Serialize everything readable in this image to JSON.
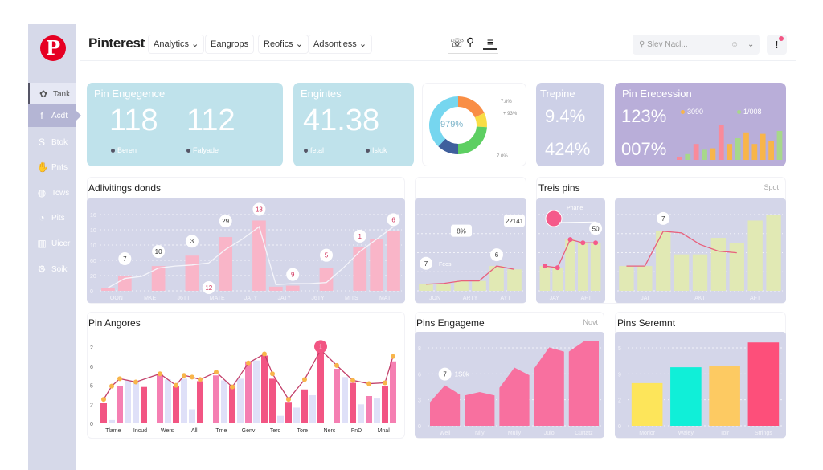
{
  "sidebar": {
    "logo": "P",
    "items": [
      {
        "label": "Tank",
        "icon": "paw-icon",
        "glyph": "✿"
      },
      {
        "label": "Acdt",
        "icon": "facebook-icon",
        "glyph": "f"
      },
      {
        "label": "Btok",
        "icon": "skype-icon",
        "glyph": "S"
      },
      {
        "label": "Pnts",
        "icon": "hand-icon",
        "glyph": "✋"
      },
      {
        "label": "Tcws",
        "icon": "globe-icon",
        "glyph": "◍"
      },
      {
        "label": "Pits",
        "icon": "gauge-icon",
        "glyph": "◔"
      },
      {
        "label": "Uicer",
        "icon": "factory-icon",
        "glyph": "▥"
      },
      {
        "label": "Soik",
        "icon": "gear-icon",
        "glyph": "⚙"
      }
    ]
  },
  "header": {
    "brand": "Pinterest",
    "menus": [
      {
        "label": "Analytics ⌄"
      },
      {
        "label": "Eangrops"
      },
      {
        "label": "Reofics ⌄"
      },
      {
        "label": "Adsontiess ⌄"
      }
    ],
    "icons": [
      "phone-icon",
      "search-icon",
      "list-icon"
    ],
    "search_placeholder": "Slev Nacl...",
    "user_icon": "user-icon",
    "bell": "!"
  },
  "kpis": {
    "engagement": {
      "title": "Pin Engegence",
      "v1": "118",
      "v2": "112",
      "l1": "Beren",
      "l2": "Falyade"
    },
    "engintes": {
      "title": "Engintes",
      "value": "41.38",
      "l1": "fetal",
      "l2": "Islok"
    },
    "donut": {
      "center": "979%",
      "labels": [
        "7.8%",
        "+ 93%",
        "7.0%"
      ],
      "segments": [
        {
          "value": 18,
          "color": "#f98e45"
        },
        {
          "value": 8,
          "color": "#f9dd45"
        },
        {
          "value": 24,
          "color": "#5dcf62"
        },
        {
          "value": 12,
          "color": "#3f5f9c"
        },
        {
          "value": 38,
          "color": "#76d6ef"
        }
      ]
    },
    "trepine": {
      "title": "Trepine",
      "v1": "9.4%",
      "v2": "424%"
    },
    "recession": {
      "title": "Pin Erecession",
      "v1": "123%",
      "v2": "007%",
      "leg1": "3090",
      "leg2": "1/008",
      "leg1_color": "#f8b54a",
      "leg2_color": "#a7d88a",
      "bars": [
        4,
        8,
        22,
        14,
        16,
        48,
        22,
        30,
        38,
        22,
        36,
        26,
        40
      ],
      "bar_colors": [
        "#f98a9a",
        "#a7d88a",
        "#f98a9a",
        "#a7d88a",
        "#f8b54a",
        "#f98a9a",
        "#f8b54a",
        "#a7d88a",
        "#f8b54a",
        "#f8b54a",
        "#f8b54a",
        "#f8b54a",
        "#a7d88a"
      ]
    }
  },
  "panels": {
    "activity_title": "Adlivitings donds",
    "trends_title": "Treis pins",
    "trends_action": "Spot",
    "angores_title": "Pin Angores",
    "engage_title": "Pins Engageme",
    "engage_action": "Novt",
    "segment_title": "Pins Seremnt"
  },
  "chart_data": [
    {
      "id": "activity",
      "type": "bar",
      "ymax": 80,
      "yticks": [
        "16",
        "10",
        "10",
        "60",
        "20",
        "0"
      ],
      "xlabels": [
        "OON",
        "MKE",
        "J6TT",
        "MATE",
        "JATY",
        "JATY",
        "J6TY",
        "MITS",
        "MAT"
      ],
      "values": [
        3,
        14,
        0,
        24,
        0,
        34,
        0,
        52,
        0,
        68,
        4,
        5,
        0,
        22,
        0,
        42,
        50,
        58
      ],
      "bar_color": "#f9b5c8",
      "line": [
        3,
        12,
        14,
        22,
        24,
        25,
        27,
        40,
        50,
        62,
        6,
        7,
        7,
        8,
        22,
        38,
        50,
        62
      ],
      "line_color": "#f4f4fa",
      "callouts": [
        {
          "i": 1,
          "label": "7",
          "dy": 22
        },
        {
          "i": 3,
          "label": "10",
          "dy": 18
        },
        {
          "i": 5,
          "label": "3",
          "dy": 18
        },
        {
          "i": 6,
          "label": "12",
          "dy": 4,
          "color": "#d0305a"
        },
        {
          "i": 7,
          "label": "29",
          "dy": 20
        },
        {
          "i": 9,
          "label": "13",
          "dy": 14,
          "color": "#d0305a"
        },
        {
          "i": 11,
          "label": "9",
          "dy": 14,
          "color": "#d0305a"
        },
        {
          "i": 13,
          "label": "5",
          "dy": 16,
          "color": "#d0305a"
        },
        {
          "i": 15,
          "label": "1",
          "dy": 14,
          "color": "#d0305a"
        },
        {
          "i": 17,
          "label": "6",
          "dy": 14,
          "color": "#d0305a"
        }
      ]
    },
    {
      "id": "pins-trend",
      "type": "bar",
      "ymax": 100,
      "yticks": [],
      "xlabels": [
        "JON",
        "ARTY",
        "AYT"
      ],
      "values": [
        8,
        8,
        12,
        12,
        30,
        26
      ],
      "bar_color": "#e1e9b4",
      "line": [
        8,
        9,
        12,
        12,
        30,
        26
      ],
      "line_color": "#e8607c",
      "callouts": [
        {
          "i": 0,
          "label": "7",
          "dy": 26
        },
        {
          "i": 2,
          "label": "8%",
          "dy": 62,
          "box": true
        },
        {
          "i": 4,
          "label": "6",
          "dy": 14
        },
        {
          "i": 5,
          "label": "22141",
          "dy": 60,
          "box": true
        }
      ],
      "note": "Feos"
    },
    {
      "id": "trends-small",
      "type": "bar",
      "ymax": 100,
      "yticks": [],
      "xlabels": [
        "JAY",
        "AFT"
      ],
      "values": [
        30,
        28,
        62,
        58,
        58
      ],
      "bar_color": "#e1e9b4",
      "line": [
        30,
        28,
        62,
        58,
        58
      ],
      "line_color": "#e8607c",
      "callouts": [
        {
          "i": 4,
          "label": "50",
          "dy": 18
        }
      ],
      "note": "Pnarle",
      "dot_color": "#f55a8a"
    },
    {
      "id": "trends-large",
      "type": "bar",
      "ymax": 100,
      "yticks": [],
      "xlabels": [
        "JAI",
        "AKT",
        "AFT"
      ],
      "values": [
        30,
        30,
        72,
        44,
        44,
        64,
        58,
        85,
        92
      ],
      "bar_color": "#e1e9b4",
      "line": [
        30,
        30,
        72,
        70,
        56,
        48,
        46
      ],
      "line_color": "#e8607c",
      "callouts": [
        {
          "i": 2,
          "label": "7",
          "dy": 16
        }
      ]
    },
    {
      "id": "angores",
      "type": "bar",
      "ymax": 10,
      "yticks": [
        "2",
        "6",
        "5",
        "2",
        "0"
      ],
      "xlabels": [
        "Tlame",
        "Incud",
        "Wers",
        "All",
        "Tme",
        "Genv",
        "Terd",
        "Tore",
        "Nerc",
        "FnD",
        "Mnal"
      ],
      "values": [
        2.5,
        0.4,
        4.5,
        5.2,
        5.2,
        4.4,
        0,
        5.9,
        5.3,
        4.5,
        5.4,
        1.7,
        5.1,
        0,
        5.8,
        5.2,
        4.6,
        5.4,
        7.5,
        7.6,
        8.2,
        5.4,
        0.9,
        2.6,
        1.9,
        4.1,
        3.4,
        8.9,
        0,
        6.6,
        5.6,
        4.9,
        2.3,
        3.3,
        3.0,
        4.5,
        7.5
      ],
      "bar_palette": [
        "#f25583",
        "#dfe0f8",
        "#f57fb2",
        "#dfe0f8",
        "#dfe0f8",
        "#f25583",
        "#fff",
        "#f57fb2",
        "#dfe0f8",
        "#f25583",
        "#dfe0f8",
        "#dfe0f8",
        "#f25583",
        "#fff",
        "#f57fb2",
        "#dfe0f8",
        "#f25583",
        "#dfe0f8",
        "#f57fb2",
        "#dfe0f8",
        "#f25583",
        "#f25583",
        "#dfe0f8",
        "#f25583",
        "#dfe0f8",
        "#f25583",
        "#dfe0f8",
        "#f25583",
        "#fff",
        "#f57fb2",
        "#dfe0f8",
        "#f25583",
        "#dfe0f8",
        "#f57fb2",
        "#dfe0f8",
        "#f25583",
        "#f57fb2"
      ],
      "line": [
        2.9,
        4.5,
        5.4,
        0,
        5.0,
        0,
        0,
        6.0,
        0,
        4.6,
        5.8,
        5.6,
        5.3,
        0,
        6.2,
        0,
        4.4,
        0,
        7.3,
        0,
        8.4,
        6.0,
        0,
        2.9,
        0,
        5.3,
        0,
        8.9,
        0,
        7.0,
        0,
        5.2,
        0,
        4.8,
        0,
        4.9,
        8.1
      ],
      "line_color": "#c2406a",
      "dot_color": "#f8b54a",
      "callouts": [
        {
          "i": 27,
          "label": "1",
          "dy": 4,
          "filled": "#f25583"
        }
      ]
    },
    {
      "id": "engagement",
      "type": "segments",
      "ymax": 10,
      "yticks": [
        "8",
        "6",
        "3",
        "0"
      ],
      "xlabels": [
        "Well",
        "Nily",
        "Mully",
        "Julo",
        "Curtatz"
      ],
      "segments": [
        [
          2.8,
          4.8,
          3.7
        ],
        [
          3.6,
          4.0,
          3.6
        ],
        [
          4.5,
          6.9,
          6.0
        ],
        [
          6.8,
          9.3,
          8.8
        ],
        [
          8.8,
          10,
          10
        ]
      ],
      "color": "#f8709f",
      "callouts": [
        {
          "i": 0,
          "label": "7",
          "dy": 14,
          "note": "1S0k"
        }
      ]
    },
    {
      "id": "segment",
      "type": "bar",
      "ymax": 8.5,
      "yticks": [
        "5",
        "9",
        "2",
        "0"
      ],
      "xlabels": [
        "Morlor",
        "Waley",
        "Tolr",
        "Strings"
      ],
      "values": [
        4.3,
        5.9,
        6.0,
        8.4
      ],
      "bar_colors": [
        "#fde55a",
        "#10efd8",
        "#fdca62",
        "#fd4f7a"
      ]
    }
  ]
}
